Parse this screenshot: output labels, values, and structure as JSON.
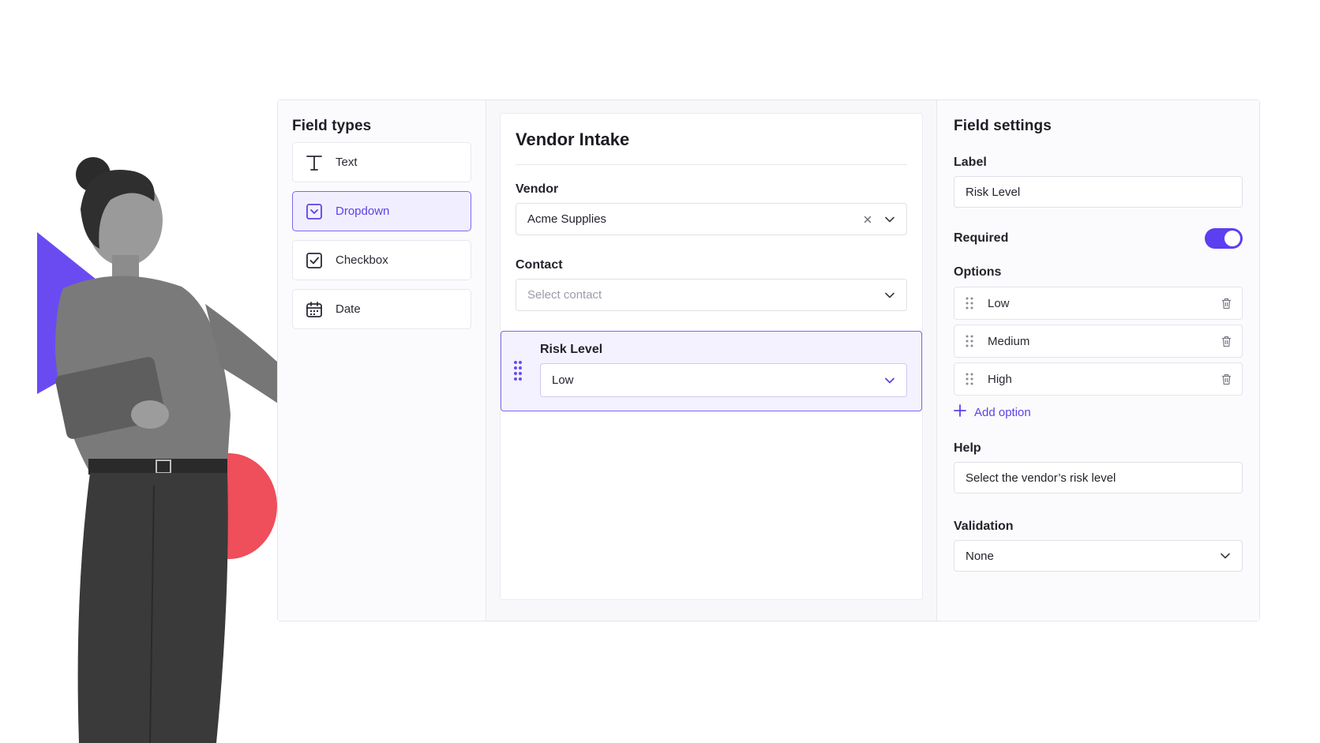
{
  "field_types": {
    "title": "Field types",
    "items": [
      {
        "label": "Text",
        "icon": "text-icon",
        "active": false
      },
      {
        "label": "Dropdown",
        "icon": "dropdown-icon",
        "active": true
      },
      {
        "label": "Checkbox",
        "icon": "checkbox-icon",
        "active": false
      },
      {
        "label": "Date",
        "icon": "calendar-icon",
        "active": false
      }
    ]
  },
  "form": {
    "title": "Vendor Intake",
    "vendor": {
      "label": "Vendor",
      "value": "Acme Supplies"
    },
    "contact": {
      "label": "Contact",
      "placeholder": "Select contact"
    },
    "risk_level": {
      "label": "Risk Level",
      "value": "Low"
    }
  },
  "settings": {
    "title": "Field settings",
    "label": {
      "label": "Label",
      "value": "Risk Level"
    },
    "required": {
      "label": "Required",
      "on": true
    },
    "options": {
      "label": "Options",
      "items": [
        "Low",
        "Medium",
        "High"
      ],
      "add_label": "Add option"
    },
    "help": {
      "label": "Help",
      "value": "Select the vendor’s risk level"
    },
    "validation": {
      "label": "Validation",
      "value": "None"
    }
  },
  "colors": {
    "accent": "#5b3ff0",
    "accent_soft": "#f1efff",
    "triangle": "#6a4bf2",
    "circle": "#ef4e5b"
  }
}
